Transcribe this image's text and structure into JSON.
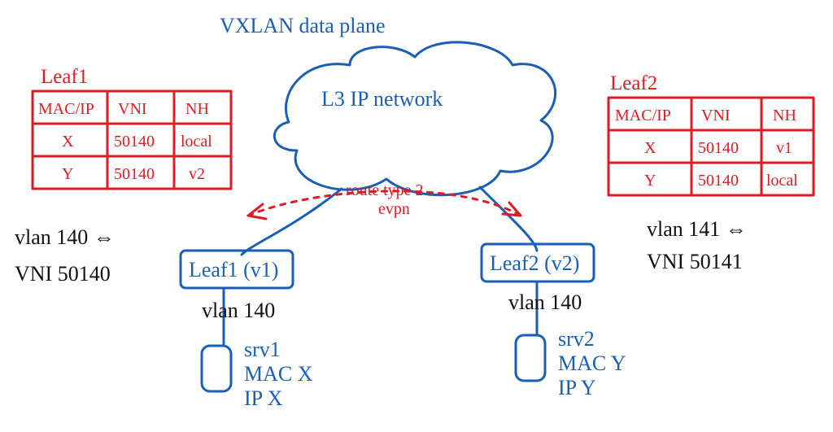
{
  "title": "VXLAN data plane",
  "cloud_label": "L3 IP network",
  "route_label_1": "route type 2",
  "route_label_2": "evpn",
  "leaf1": {
    "label": "Leaf1",
    "node": "Leaf1 (v1)",
    "link_vlan": "vlan 140",
    "server": {
      "name": "srv1",
      "mac": "MAC X",
      "ip": "IP X"
    },
    "side": {
      "vlan": "vlan 140 ⇔",
      "vni": "VNI 50140"
    },
    "table": {
      "h": [
        "MAC/IP",
        "VNI",
        "NH"
      ],
      "r1": [
        "X",
        "50140",
        "local"
      ],
      "r2": [
        "Y",
        "50140",
        "v2"
      ]
    }
  },
  "leaf2": {
    "label": "Leaf2",
    "node": "Leaf2 (v2)",
    "link_vlan": "vlan 140",
    "server": {
      "name": "srv2",
      "mac": "MAC Y",
      "ip": "IP Y"
    },
    "side": {
      "vlan": "vlan 141 ⇔",
      "vni": "VNI 50141"
    },
    "table": {
      "h": [
        "MAC/IP",
        "VNI",
        "NH"
      ],
      "r1": [
        "X",
        "50140",
        "v1"
      ],
      "r2": [
        "Y",
        "50140",
        "local"
      ]
    }
  }
}
